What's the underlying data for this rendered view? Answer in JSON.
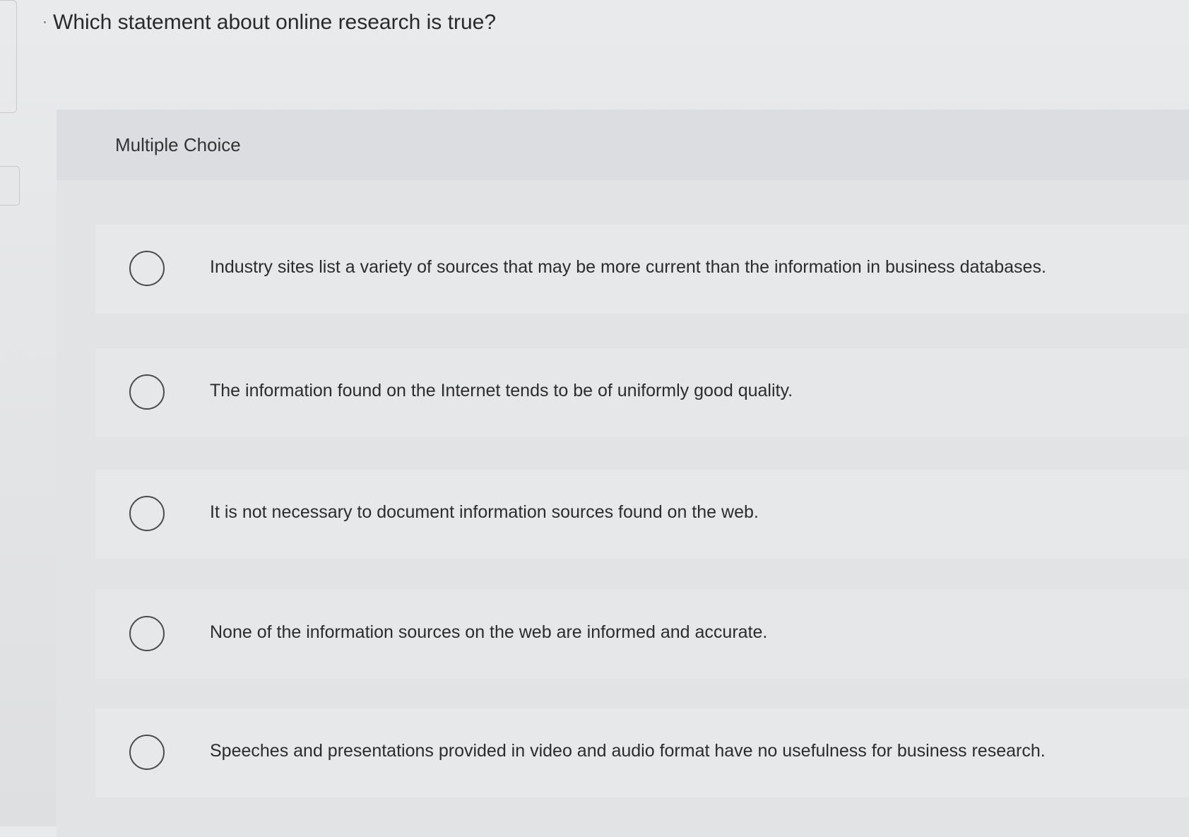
{
  "question": {
    "text": "Which statement about online research is true?"
  },
  "question_type": {
    "label": "Multiple Choice"
  },
  "choices": [
    {
      "label": "Industry sites list a variety of sources that may be more current than the information in business databases."
    },
    {
      "label": "The information found on the Internet tends to be of uniformly good quality."
    },
    {
      "label": "It is not necessary to document information sources found on the web."
    },
    {
      "label": "None of the information sources on the web are informed and accurate."
    },
    {
      "label": "Speeches and presentations provided in video and audio format have no usefulness for business research."
    }
  ],
  "colors": {
    "background": "#e6e7e9",
    "text": "#2b2b2b",
    "radio_border": "#4b4b4d"
  }
}
